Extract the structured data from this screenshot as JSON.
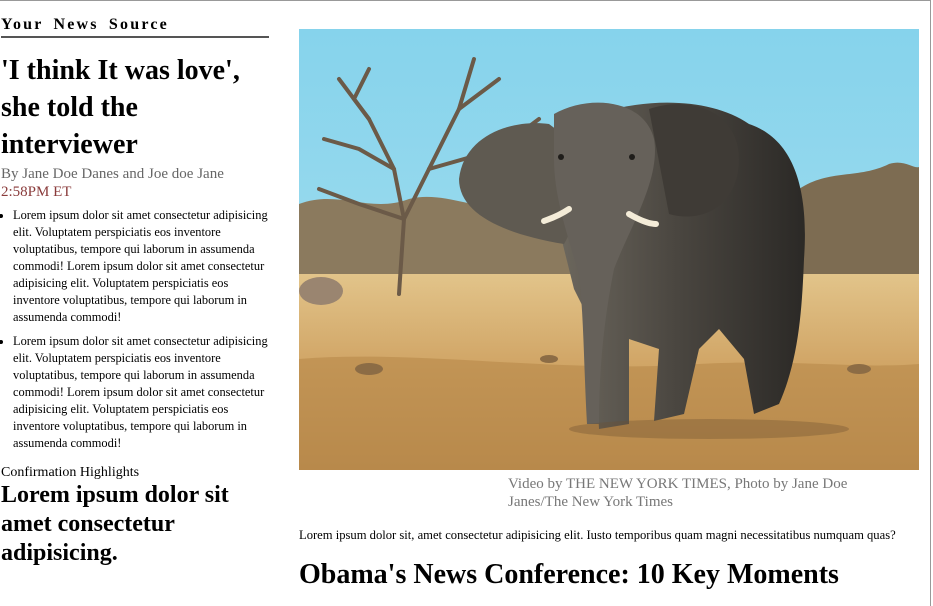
{
  "section": {
    "title": "Your News Source"
  },
  "article": {
    "headline": "'I think It was love', she told the interviewer",
    "byline": "By Jane Doe Danes and Joe doe Jane",
    "time": "2:58PM ET",
    "bullets": [
      "Lorem ipsum dolor sit amet consectetur adipisicing elit. Voluptatem perspiciatis eos inventore voluptatibus, tempore qui laborum in assumenda commodi! Lorem ipsum dolor sit amet consectetur adipisicing elit. Voluptatem perspiciatis eos inventore voluptatibus, tempore qui laborum in assumenda commodi!",
      "Lorem ipsum dolor sit amet consectetur adipisicing elit. Voluptatem perspiciatis eos inventore voluptatibus, tempore qui laborum in assumenda commodi! Lorem ipsum dolor sit amet consectetur adipisicing elit. Voluptatem perspiciatis eos inventore voluptatibus, tempore qui laborum in assumenda commodi!"
    ]
  },
  "highlights": {
    "label": "Confirmation Highlights",
    "headline": "Lorem ipsum dolor sit amet consectetur adipisicing."
  },
  "media": {
    "image_subject": "elephant-photo",
    "caption": "Video by THE NEW YORK TIMES, Photo by Jane Doe Janes/The New York Times"
  },
  "feature": {
    "lead": "Lorem ipsum dolor sit, amet consectetur adipisicing elit. Iusto temporibus quam magni necessitatibus numquam quas?",
    "title": "Obama's News Conference: 10 Key Moments"
  },
  "colors": {
    "byline": "#666666",
    "time": "#8a3b3b",
    "caption": "#777777",
    "sky": "#8fd7ec",
    "ground": "#c99a5a"
  }
}
